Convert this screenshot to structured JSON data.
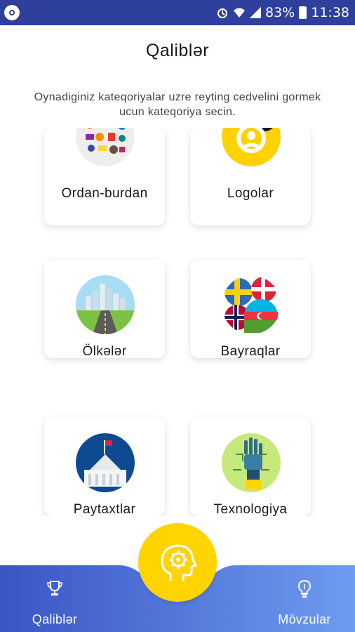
{
  "status_bar": {
    "battery": "83%",
    "time": "11:38"
  },
  "header": {
    "title": "Qaliblər",
    "subtitle": "Oynadiginiz kateqoriyalar uzre reyting cedvelini gormek ucun kateqoriya secin."
  },
  "categories": [
    {
      "label": "Ordan-burdan",
      "icon": "collage-icon"
    },
    {
      "label": "Logolar",
      "icon": "logos-icon"
    },
    {
      "label": "Ölkələr",
      "icon": "city-road-icon"
    },
    {
      "label": "Bayraqlar",
      "icon": "flags-icon"
    },
    {
      "label": "Paytaxtlar",
      "icon": "capitol-icon"
    },
    {
      "label": "Texnologiya",
      "icon": "robot-hand-icon"
    }
  ],
  "bottom_nav": {
    "left_label": "Qaliblər",
    "right_label": "Mövzular",
    "left_icon": "trophy-icon",
    "right_icon": "lightbulb-icon",
    "center_icon": "head-gear-icon"
  },
  "colors": {
    "status_bar": "#2f3f9c",
    "nav_gradient_start": "#3a55c4",
    "nav_gradient_end": "#6e9bf0",
    "fab": "#ffd400"
  }
}
